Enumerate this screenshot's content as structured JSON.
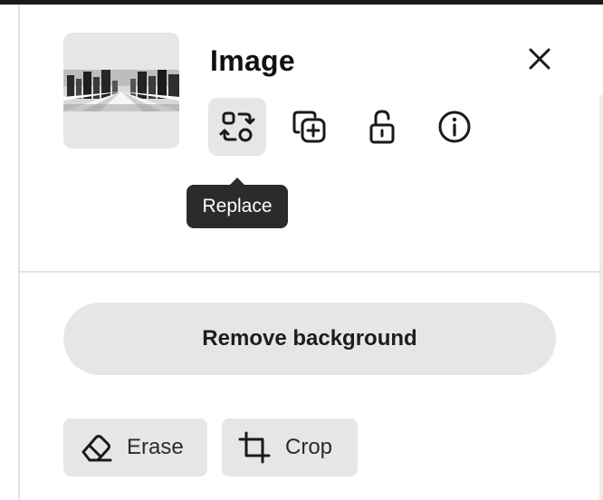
{
  "panel": {
    "title": "Image",
    "close_icon": "close-icon",
    "thumbnail_alt": "image-thumbnail"
  },
  "toolbar": {
    "tools": [
      {
        "icon": "replace-icon",
        "active": true
      },
      {
        "icon": "duplicate-icon",
        "active": false
      },
      {
        "icon": "unlock-icon",
        "active": false
      },
      {
        "icon": "info-icon",
        "active": false
      }
    ],
    "tooltip": "Replace"
  },
  "actions": {
    "remove_background_label": "Remove background",
    "erase_label": "Erase",
    "crop_label": "Crop"
  },
  "colors": {
    "chip_bg": "#e6e6e6",
    "tooltip_bg": "#2b2b2b",
    "text_primary": "#111111"
  }
}
